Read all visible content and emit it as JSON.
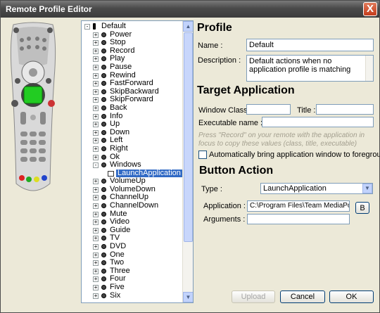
{
  "window": {
    "title": "Remote Profile Editor",
    "close_glyph": "X"
  },
  "tree": {
    "root_label": "Default",
    "items": [
      {
        "label": "Power",
        "exp": "+"
      },
      {
        "label": "Stop",
        "exp": "+"
      },
      {
        "label": "Record",
        "exp": "+"
      },
      {
        "label": "Play",
        "exp": "+"
      },
      {
        "label": "Pause",
        "exp": "+"
      },
      {
        "label": "Rewind",
        "exp": "+"
      },
      {
        "label": "FastForward",
        "exp": "+"
      },
      {
        "label": "SkipBackward",
        "exp": "+"
      },
      {
        "label": "SkipForward",
        "exp": "+"
      },
      {
        "label": "Back",
        "exp": "+"
      },
      {
        "label": "Info",
        "exp": "+"
      },
      {
        "label": "Up",
        "exp": "+"
      },
      {
        "label": "Down",
        "exp": "+"
      },
      {
        "label": "Left",
        "exp": "+"
      },
      {
        "label": "Right",
        "exp": "+"
      },
      {
        "label": "Ok",
        "exp": "+"
      },
      {
        "label": "Windows",
        "exp": "-"
      },
      {
        "label": "LaunchApplication",
        "child": true,
        "selected": true
      },
      {
        "label": "VolumeUp",
        "exp": "+"
      },
      {
        "label": "VolumeDown",
        "exp": "+"
      },
      {
        "label": "ChannelUp",
        "exp": "+"
      },
      {
        "label": "ChannelDown",
        "exp": "+"
      },
      {
        "label": "Mute",
        "exp": "+"
      },
      {
        "label": "Video",
        "exp": "+"
      },
      {
        "label": "Guide",
        "exp": "+"
      },
      {
        "label": "TV",
        "exp": "+"
      },
      {
        "label": "DVD",
        "exp": "+"
      },
      {
        "label": "One",
        "exp": "+"
      },
      {
        "label": "Two",
        "exp": "+"
      },
      {
        "label": "Three",
        "exp": "+"
      },
      {
        "label": "Four",
        "exp": "+"
      },
      {
        "label": "Five",
        "exp": "+"
      },
      {
        "label": "Six",
        "exp": "+"
      }
    ]
  },
  "profile": {
    "heading": "Profile",
    "name_label": "Name :",
    "name_value": "Default",
    "description_label": "Description :",
    "description_value": "Default actions when no application profile is matching"
  },
  "target": {
    "heading": "Target Application",
    "window_class_label": "Window Class :",
    "window_class_value": "",
    "title_label": "Title :",
    "title_value": "",
    "executable_label": "Executable name :",
    "executable_value": "",
    "hint": "Press \"Record\" on your remote with the application in focus to copy these values (class, title, executable)",
    "auto_foreground_label": "Automatically bring application window to foreground"
  },
  "action": {
    "heading": "Button Action",
    "type_label": "Type :",
    "type_value": "LaunchApplication",
    "application_label": "Application :",
    "application_value": "C:\\Program Files\\Team MediaPortal",
    "browse_label": "B",
    "arguments_label": "Arguments :",
    "arguments_value": ""
  },
  "buttons": {
    "upload": "Upload",
    "cancel": "Cancel",
    "ok": "OK"
  }
}
